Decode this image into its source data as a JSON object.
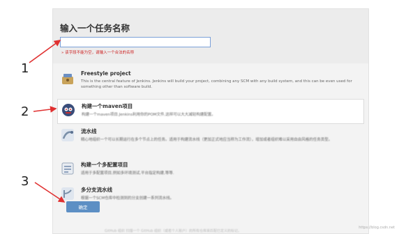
{
  "page": {
    "title": "输入一个任务名称",
    "input_value": "",
    "error_text": "» 该字段不能为空，请输入一个合法的名称",
    "ok_label": "确定"
  },
  "items": [
    {
      "name": "Freestyle project",
      "desc": "This is the central feature of Jenkins. Jenkins will build your project, combining any SCM with any build system, and this can be even used for something other than software build.",
      "icon": "freestyle-icon"
    },
    {
      "name": "构建一个maven项目",
      "desc": "构建一个maven项目.Jenkins利用你的POM文件,这样可以大大减轻构建配置。",
      "icon": "maven-icon"
    },
    {
      "name": "流水线",
      "desc": "精心地组织一个可以长期运行在多个节点上的任务。适用于构建流水线（更加正式地应当称为工作流），增加或者组织难以采用自由风格的任务类型。",
      "icon": "pipeline-icon"
    },
    {
      "name": "构建一个多配置项目",
      "desc": "适用于多配置项目,例如多环境测试,平台指定构建,等等.",
      "icon": "multiconfig-icon"
    },
    {
      "name": "多分支流水线",
      "desc": "根据一个SCM仓库中检测到的分支创建一系列流水线。",
      "icon": "multibranch-icon"
    }
  ],
  "annotations": [
    "1",
    "2",
    "3"
  ],
  "bottom_text": "GitHub 组织 扫描一个 GitHub 组织（或者个人账户）的所有仓库来匹配已定义的标记。",
  "watermark": "https://blog.csdn.net",
  "colors": {
    "arrow": "#e03030",
    "ok_button": "#5d8fc4",
    "error": "#cc2222"
  }
}
